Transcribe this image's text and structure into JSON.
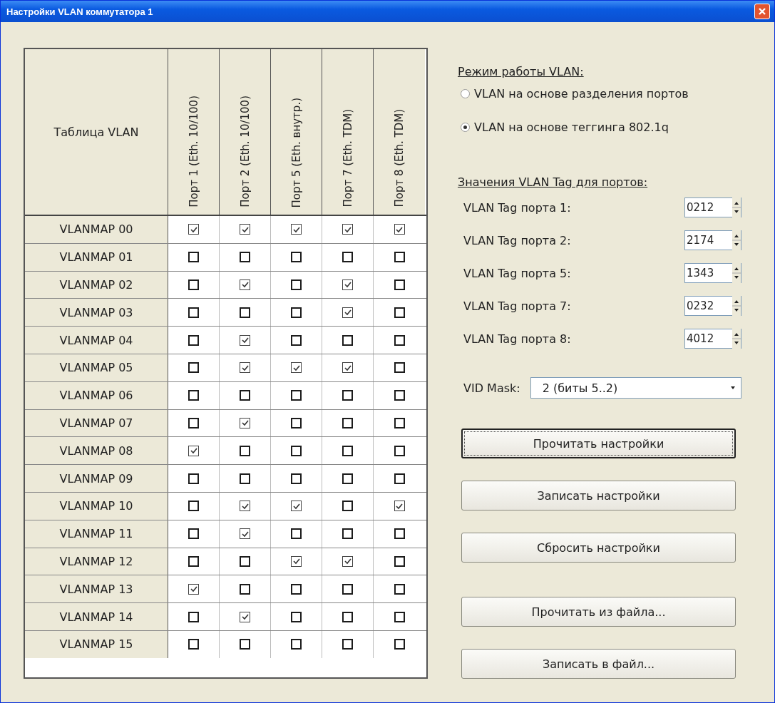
{
  "window": {
    "title": "Настройки VLAN коммутатора 1"
  },
  "table": {
    "corner": "Таблица VLAN",
    "columns": [
      "Порт 1 (Eth. 10/100)",
      "Порт 2 (Eth. 10/100)",
      "Порт 5 (Eth. внутр.)",
      "Порт 7 (Eth. TDM)",
      "Порт 8 (Eth. TDM)"
    ],
    "rows": [
      {
        "label": "VLANMAP 00",
        "checked": [
          true,
          true,
          true,
          true,
          true
        ]
      },
      {
        "label": "VLANMAP 01",
        "checked": [
          false,
          false,
          false,
          false,
          false
        ]
      },
      {
        "label": "VLANMAP 02",
        "checked": [
          false,
          true,
          false,
          true,
          false
        ]
      },
      {
        "label": "VLANMAP 03",
        "checked": [
          false,
          false,
          false,
          true,
          false
        ]
      },
      {
        "label": "VLANMAP 04",
        "checked": [
          false,
          true,
          false,
          false,
          false
        ]
      },
      {
        "label": "VLANMAP 05",
        "checked": [
          false,
          true,
          true,
          true,
          false
        ]
      },
      {
        "label": "VLANMAP 06",
        "checked": [
          false,
          false,
          false,
          false,
          false
        ]
      },
      {
        "label": "VLANMAP 07",
        "checked": [
          false,
          true,
          false,
          false,
          false
        ]
      },
      {
        "label": "VLANMAP 08",
        "checked": [
          true,
          false,
          false,
          false,
          false
        ]
      },
      {
        "label": "VLANMAP 09",
        "checked": [
          false,
          false,
          false,
          false,
          false
        ]
      },
      {
        "label": "VLANMAP 10",
        "checked": [
          false,
          true,
          true,
          false,
          true
        ]
      },
      {
        "label": "VLANMAP 11",
        "checked": [
          false,
          true,
          false,
          false,
          false
        ]
      },
      {
        "label": "VLANMAP 12",
        "checked": [
          false,
          false,
          true,
          true,
          false
        ]
      },
      {
        "label": "VLANMAP 13",
        "checked": [
          true,
          false,
          false,
          false,
          false
        ]
      },
      {
        "label": "VLANMAP 14",
        "checked": [
          false,
          true,
          false,
          false,
          false
        ]
      },
      {
        "label": "VLANMAP 15",
        "checked": [
          false,
          false,
          false,
          false,
          false
        ]
      }
    ]
  },
  "mode": {
    "heading": "Режим работы VLAN:",
    "options": [
      {
        "label": "VLAN на основе разделения портов",
        "selected": false
      },
      {
        "label": "VLAN на основе теггинга 802.1q",
        "selected": true
      }
    ]
  },
  "tags": {
    "heading": "Значения VLAN Tag для портов:",
    "items": [
      {
        "label": "VLAN Tag порта 1:",
        "value": "0212"
      },
      {
        "label": "VLAN Tag порта 2:",
        "value": "2174"
      },
      {
        "label": "VLAN Tag порта 5:",
        "value": "1343"
      },
      {
        "label": "VLAN Tag порта 7:",
        "value": "0232"
      },
      {
        "label": "VLAN Tag порта 8:",
        "value": "4012"
      }
    ]
  },
  "vid_mask": {
    "label": "VID Mask:",
    "value": "2  (биты 5..2)"
  },
  "buttons": [
    {
      "label": "Прочитать настройки",
      "default": true
    },
    {
      "label": "Записать настройки",
      "default": false
    },
    {
      "label": "Сбросить настройки",
      "default": false
    }
  ],
  "file_buttons": [
    {
      "label": "Прочитать из файла..."
    },
    {
      "label": "Записать в файл..."
    }
  ]
}
